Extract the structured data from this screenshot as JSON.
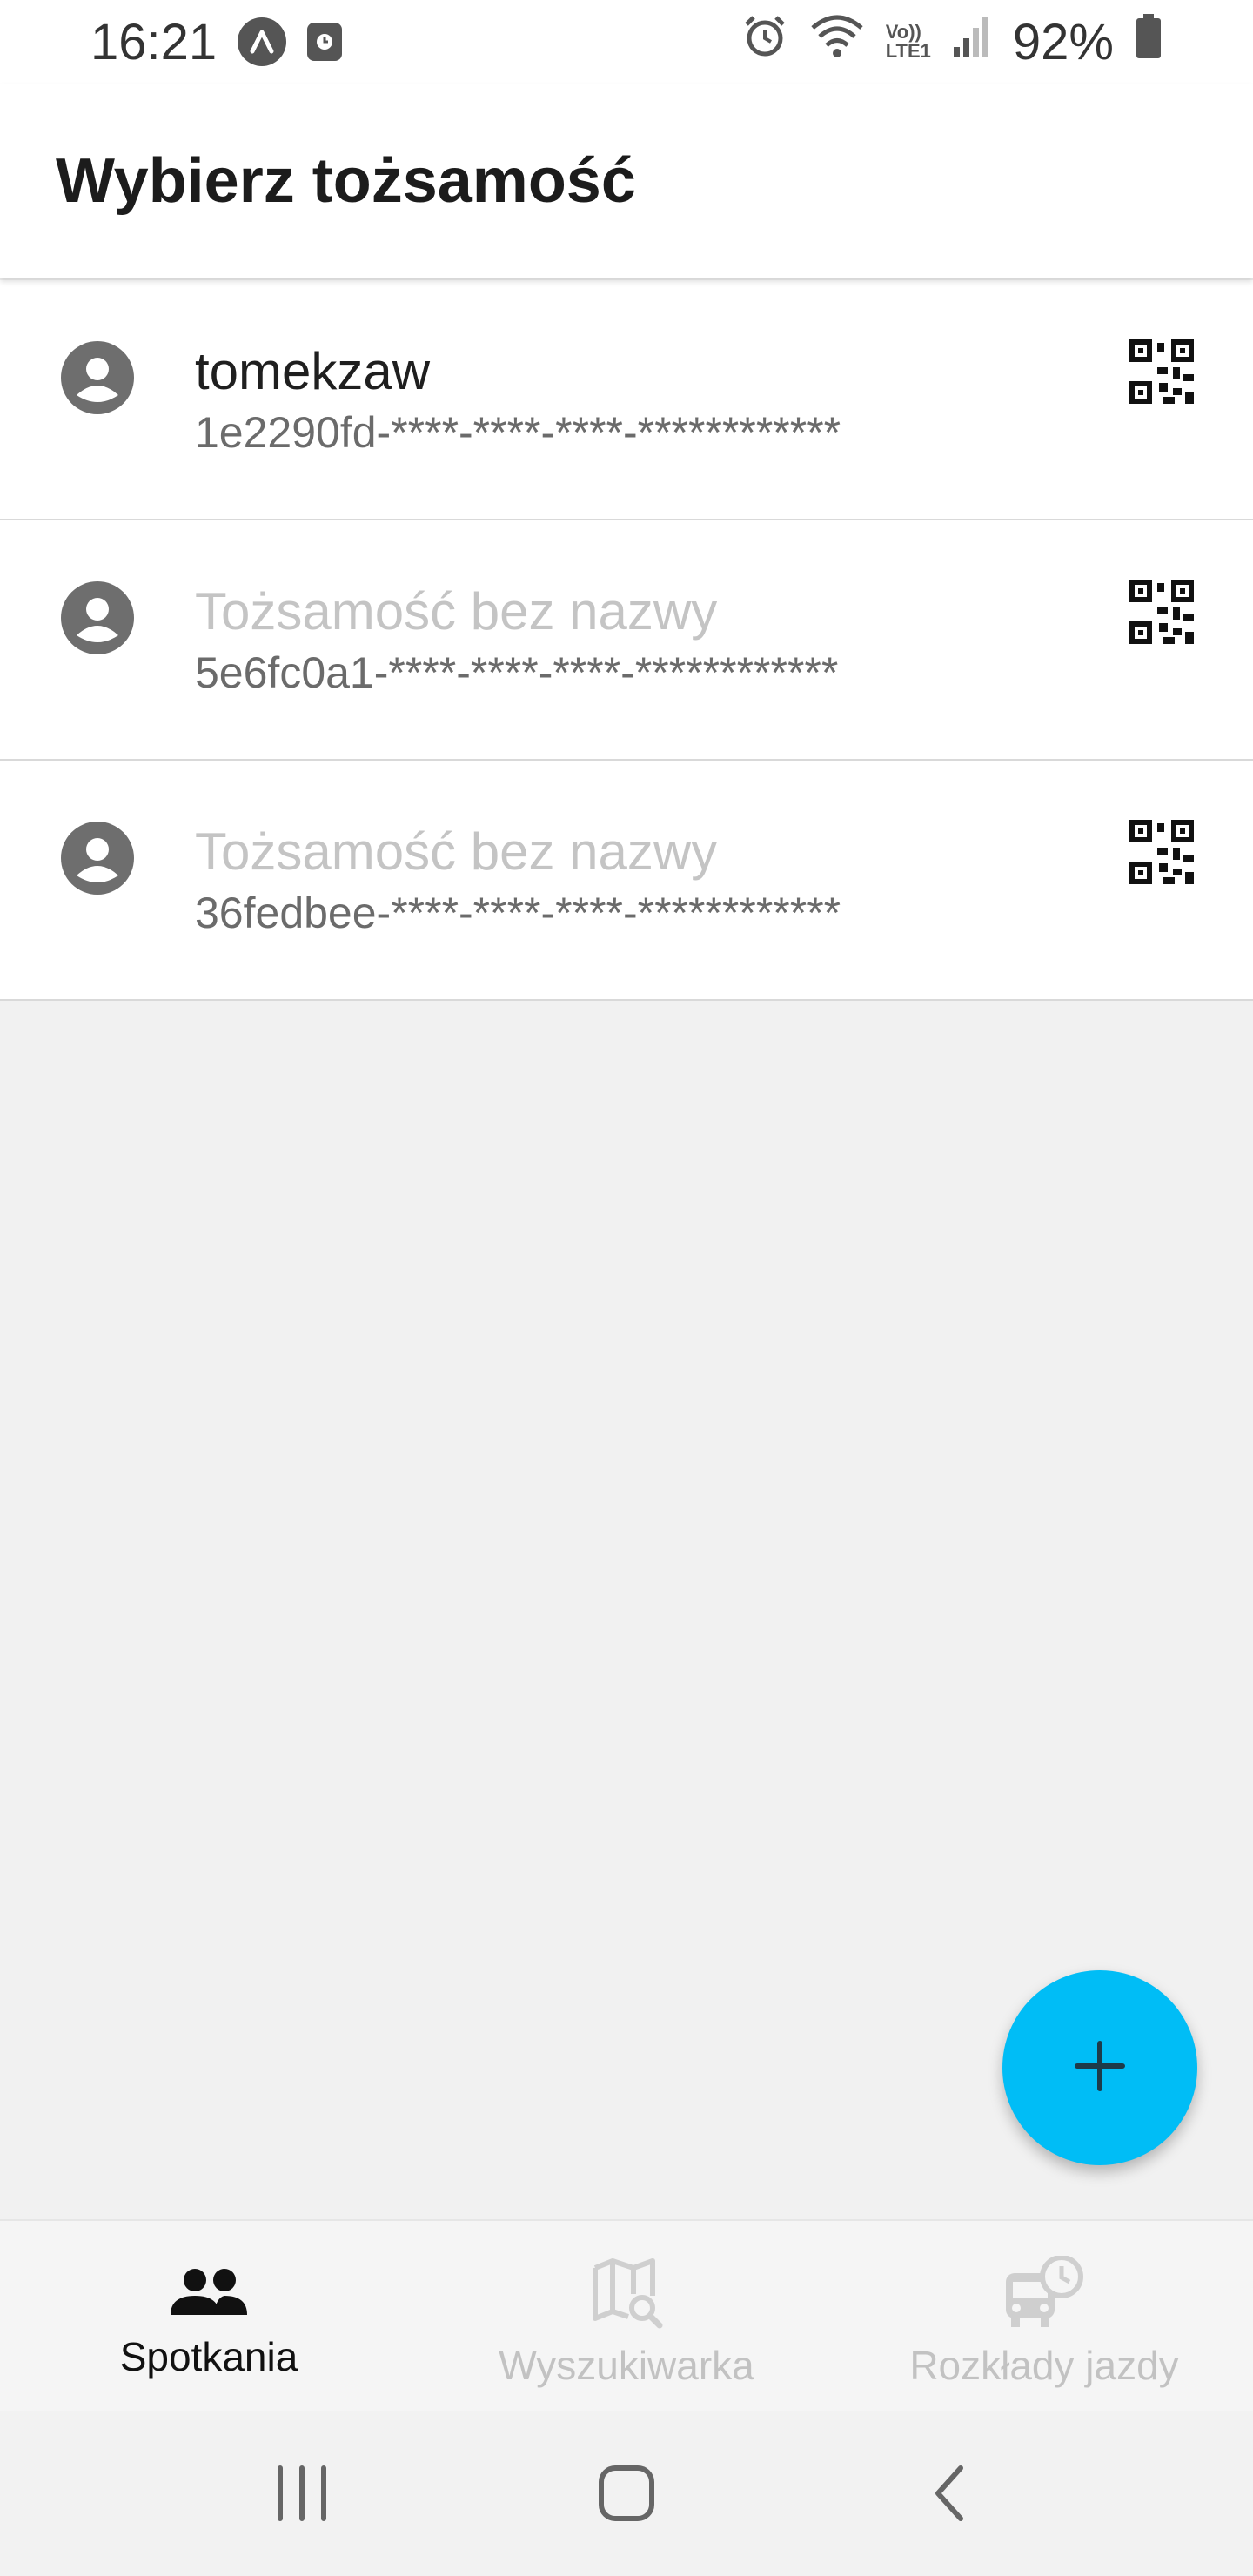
{
  "status_bar": {
    "time": "16:21",
    "left_icons": [
      "app-arrow-icon",
      "clock-badge-icon"
    ],
    "right_icons": [
      "alarm-icon",
      "wifi-icon",
      "volte-lte-icon",
      "signal-icon",
      "battery-icon"
    ],
    "network_label_top": "Vo))",
    "network_label_bottom": "LTE1",
    "battery_percent": "92%"
  },
  "app_bar": {
    "title": "Wybierz tożsamość"
  },
  "identities": [
    {
      "name": "tomekzaw",
      "id": "1e2290fd-****-****-****-************",
      "unnamed": false
    },
    {
      "name": "Tożsamość bez nazwy",
      "id": "5e6fc0a1-****-****-****-************",
      "unnamed": true
    },
    {
      "name": "Tożsamość bez nazwy",
      "id": "36fedbee-****-****-****-************",
      "unnamed": true
    }
  ],
  "fab": {
    "icon": "plus-icon",
    "color": "#00bdf6"
  },
  "bottom_nav": {
    "items": [
      {
        "label": "Spotkania",
        "icon": "people-icon",
        "active": true
      },
      {
        "label": "Wyszukiwarka",
        "icon": "map-search-icon",
        "active": false
      },
      {
        "label": "Rozkłady jazdy",
        "icon": "bus-clock-icon",
        "active": false
      }
    ]
  },
  "system_nav": {
    "buttons": [
      "recent-apps-icon",
      "home-icon",
      "back-icon"
    ]
  },
  "colors": {
    "accent": "#00bdf6",
    "background": "#f1f1f1",
    "surface": "#ffffff",
    "inactive_text": "#c2c2c2",
    "unnamed_text": "#c4c4c4"
  }
}
